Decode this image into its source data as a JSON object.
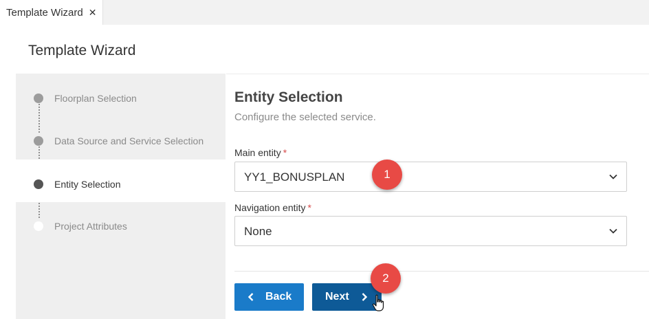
{
  "tab": {
    "label": "Template Wizard",
    "close_glyph": "✕"
  },
  "page_title": "Template Wizard",
  "steps": [
    {
      "label": "Floorplan Selection",
      "state": "done"
    },
    {
      "label": "Data Source and Service Selection",
      "state": "done"
    },
    {
      "label": "Entity Selection",
      "state": "current"
    },
    {
      "label": "Project Attributes",
      "state": "pending"
    }
  ],
  "section": {
    "title": "Entity Selection",
    "subtitle": "Configure the selected service."
  },
  "fields": {
    "main_entity": {
      "label": "Main entity",
      "required_mark": "*",
      "value": "YY1_BONUSPLAN"
    },
    "navigation_entity": {
      "label": "Navigation entity",
      "required_mark": "*",
      "value": "None"
    }
  },
  "buttons": {
    "back": "Back",
    "next": "Next"
  },
  "badges": [
    "1",
    "2"
  ],
  "colors": {
    "back_button": "#1a7bc9",
    "next_button": "#0e5a97",
    "badge": "#e84a45",
    "required": "#d64b4b"
  },
  "icons": {
    "tab_close": "close-icon",
    "dropdown": "chevron-down-icon",
    "back": "chevron-left-icon",
    "next": "chevron-right-icon",
    "cursor": "hand-pointer-icon"
  }
}
